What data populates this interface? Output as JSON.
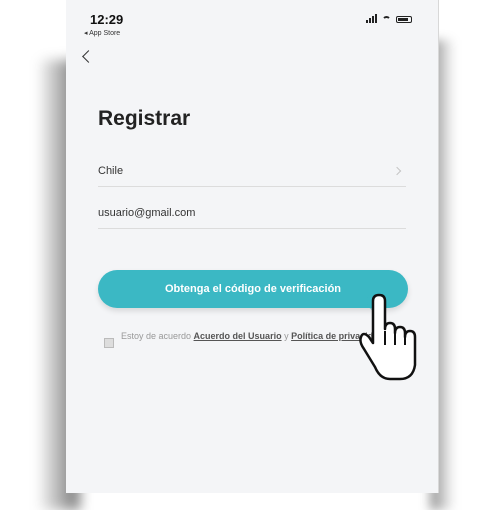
{
  "status_bar": {
    "time": "12:29",
    "back_app": "◂ App Store"
  },
  "page": {
    "title": "Registrar"
  },
  "form": {
    "country_value": "Chile",
    "email_value": "usuario@gmail.com"
  },
  "actions": {
    "verify_button": "Obtenga el código de verificación"
  },
  "agreement": {
    "prefix": "Estoy de acuerdo ",
    "user_agreement_link": "Acuerdo del Usuario",
    "conjunction": " y ",
    "privacy_link": "Política de privacidad"
  },
  "colors": {
    "accent": "#3bb8c4",
    "background": "#f4f5f7"
  },
  "icons": [
    "back-arrow-icon",
    "signal-icon",
    "wifi-icon",
    "battery-icon",
    "chevron-right-icon",
    "pointer-hand-icon"
  ]
}
